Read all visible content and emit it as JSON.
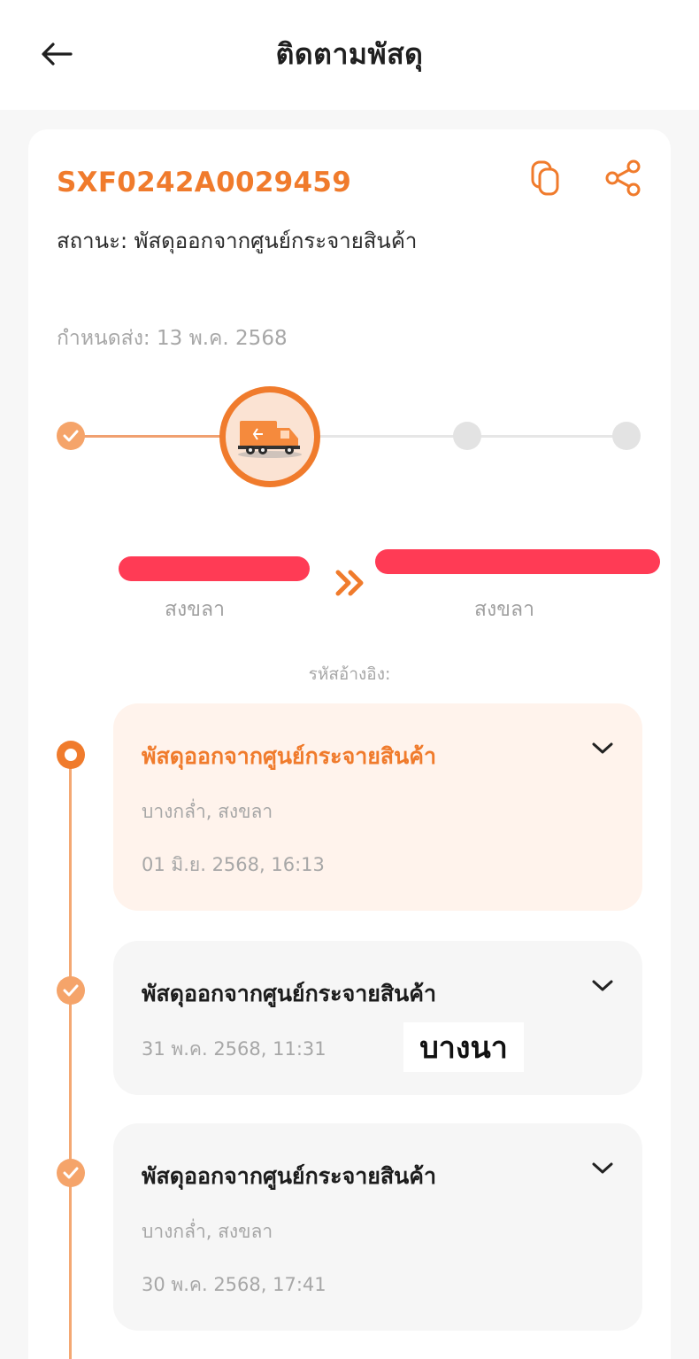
{
  "header": {
    "title": "ติดตามพัสดุ"
  },
  "shipment": {
    "tracking_number": "SXF0242A0029459",
    "status": "สถานะ: พัสดุออกจากศูนย์กระจายสินค้า",
    "due": "กำหนดส่ง: 13 พ.ค. 2568",
    "progress_step": 2,
    "progress_total": 4
  },
  "route": {
    "from_province": "สงขลา",
    "to_province": "สงขลา",
    "reference": "รหัสอ้างอิง:"
  },
  "events": [
    {
      "title": "พัสดุออกจากศูนย์กระจายสินค้า",
      "location": "บางกล่ำ, สงขลา",
      "time": "01 มิ.ย. 2568, 16:13"
    },
    {
      "title": "พัสดุออกจากศูนย์กระจายสินค้า",
      "time": "31 พ.ค. 2568, 11:31"
    },
    {
      "title": "พัสดุออกจากศูนย์กระจายสินค้า",
      "location": "บางกล่ำ, สงขลา",
      "time": "30 พ.ค. 2568, 17:41"
    }
  ],
  "overlay_text": "บางนา",
  "colors": {
    "accent": "#f07b2c",
    "accent_light": "#f5a46a",
    "active_card_bg": "#fff3ec",
    "redaction": "#ff3b55"
  },
  "icons": {
    "back": "arrow-left-icon",
    "copy": "copy-icon",
    "share": "share-icon",
    "truck": "truck-icon",
    "arrows": "double-chevron-right-icon",
    "expand": "chevron-down-icon",
    "check": "check-icon"
  }
}
